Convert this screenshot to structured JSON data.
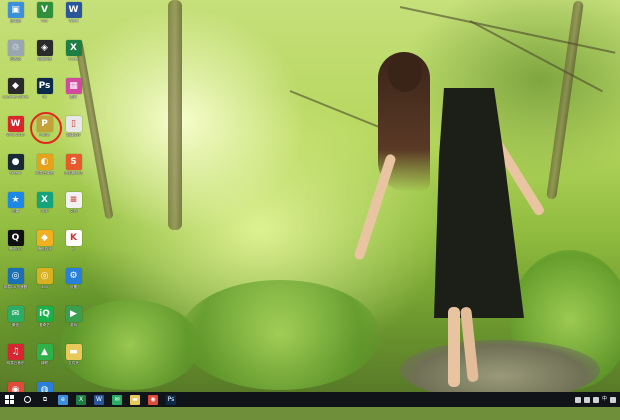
{
  "desktop": {
    "icons": [
      {
        "id": "ico-1",
        "label": "此电脑",
        "color": "#3c8fd8",
        "glyph": "▣"
      },
      {
        "id": "ico-2",
        "label": "回收站",
        "color": "#9aa6b2",
        "glyph": "♲"
      },
      {
        "id": "ico-3",
        "label": "Counter-Strike",
        "color": "#2a2a2a",
        "glyph": "◆"
      },
      {
        "id": "ico-4",
        "label": "WPS 2019",
        "color": "#d9262c",
        "glyph": "W"
      },
      {
        "id": "ico-5",
        "label": "Steam",
        "color": "#1b2838",
        "glyph": "●"
      },
      {
        "id": "ico-6",
        "label": "迅雷",
        "color": "#1e88e5",
        "glyph": "★"
      },
      {
        "id": "ico-7",
        "label": "腾讯QQ",
        "color": "#111111",
        "glyph": "Q"
      },
      {
        "id": "ico-8",
        "label": "网易UU加速器",
        "color": "#1c6fb5",
        "glyph": "◎"
      },
      {
        "id": "ico-9",
        "label": "微信",
        "color": "#2aae67",
        "glyph": "✉"
      },
      {
        "id": "ico-10",
        "label": "网易云音乐",
        "color": "#d6262f",
        "glyph": "♫"
      },
      {
        "id": "ico-11",
        "label": "Google Chrome",
        "color": "#e04a3a",
        "glyph": "◉"
      },
      {
        "id": "ico-12",
        "label": "Vim",
        "color": "#2f8f3a",
        "glyph": "V"
      },
      {
        "id": "ico-13",
        "label": "百度网盘",
        "color": "#2a2a2a",
        "glyph": "◈"
      },
      {
        "id": "ico-14",
        "label": "Ps",
        "color": "#0c2a4a",
        "glyph": "Ps"
      },
      {
        "id": "ico-15",
        "label": "PUBG",
        "color": "#c4a23a",
        "glyph": "P"
      },
      {
        "id": "ico-16",
        "label": "网易云课堂",
        "color": "#e6a21a",
        "glyph": "◐"
      },
      {
        "id": "ico-17",
        "label": "剪映",
        "color": "#15a37a",
        "glyph": "X"
      },
      {
        "id": "ico-18",
        "label": "腾讯游戏",
        "color": "#f0b020",
        "glyph": "◆"
      },
      {
        "id": "ico-19",
        "label": "360",
        "color": "#d9b020",
        "glyph": "◎"
      },
      {
        "id": "ico-20",
        "label": "爱奇艺",
        "color": "#18b14a",
        "glyph": "iQ"
      },
      {
        "id": "ico-21",
        "label": "绿联",
        "color": "#2fb14a",
        "glyph": "▲"
      },
      {
        "id": "ico-22",
        "label": "Firefox",
        "color": "#2a7fd8",
        "glyph": "◍"
      },
      {
        "id": "ico-23",
        "label": "Word",
        "color": "#2b579a",
        "glyph": "W"
      },
      {
        "id": "ico-24",
        "label": "Excel",
        "color": "#1e7f45",
        "glyph": "X"
      },
      {
        "id": "ico-25",
        "label": "图片",
        "color": "#d24aa0",
        "glyph": "▦"
      },
      {
        "id": "ico-26",
        "label": "新建文件",
        "color": "#e8e8e8",
        "glyph": "▯"
      },
      {
        "id": "ico-27",
        "label": "搜狗输入法",
        "color": "#e8592b",
        "glyph": "S"
      },
      {
        "id": "ico-28",
        "label": "文档",
        "color": "#f2f2f2",
        "glyph": "≡"
      },
      {
        "id": "ico-29",
        "label": "K",
        "color": "#ffffff",
        "glyph": "K"
      },
      {
        "id": "ico-30",
        "label": "设置",
        "color": "#2a7fd8",
        "glyph": "⚙"
      },
      {
        "id": "ico-31",
        "label": "游戏",
        "color": "#3aa050",
        "glyph": "▶"
      },
      {
        "id": "ico-32",
        "label": "文件夹",
        "color": "#e8c95a",
        "glyph": "▬"
      }
    ]
  },
  "taskbar": {
    "items": [
      {
        "id": "start",
        "glyph": ""
      },
      {
        "id": "search",
        "glyph": ""
      },
      {
        "id": "taskview",
        "glyph": "⧉"
      },
      {
        "id": "edge",
        "glyph": "e",
        "color": "#3c8fd8"
      },
      {
        "id": "excel",
        "glyph": "X",
        "color": "#1e7f45"
      },
      {
        "id": "word",
        "glyph": "W",
        "color": "#2b579a"
      },
      {
        "id": "wechat",
        "glyph": "✉",
        "color": "#2aae67"
      },
      {
        "id": "files",
        "glyph": "▬",
        "color": "#e8c95a"
      },
      {
        "id": "chrome",
        "glyph": "◉",
        "color": "#e04a3a"
      },
      {
        "id": "photoshop",
        "glyph": "Ps",
        "color": "#0c2a4a"
      }
    ],
    "tray": {
      "time": "",
      "lang": "中"
    }
  }
}
